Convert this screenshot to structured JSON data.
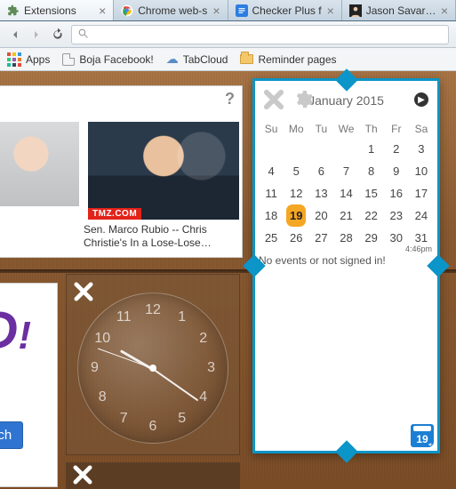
{
  "tabs": [
    {
      "title": "Extensions"
    },
    {
      "title": "Chrome web-s"
    },
    {
      "title": "Checker Plus f"
    },
    {
      "title": "Jason Savard -"
    }
  ],
  "toolbar": {
    "omnibox_placeholder": ""
  },
  "bookmarks": {
    "apps": "Apps",
    "items": [
      {
        "label": "Boja Facebook!"
      },
      {
        "label": "TabCloud"
      },
      {
        "label": "Reminder pages"
      }
    ]
  },
  "news": {
    "help": "?",
    "badge": "TMZ.COM",
    "caption": "Sen. Marco Rubio -- Chris Christie's In a Lose-Lose…"
  },
  "yahoo": {
    "search_label": "arch"
  },
  "clock": {
    "numbers": [
      "12",
      "1",
      "2",
      "3",
      "4",
      "5",
      "6",
      "7",
      "8",
      "9",
      "10",
      "11"
    ]
  },
  "calendar": {
    "title": "January 2015",
    "weekdays": [
      "Su",
      "Mo",
      "Tu",
      "We",
      "Th",
      "Fr",
      "Sa"
    ],
    "rows": [
      [
        "",
        "",
        "",
        "",
        "1",
        "2",
        "3"
      ],
      [
        "4",
        "5",
        "6",
        "7",
        "8",
        "9",
        "10"
      ],
      [
        "11",
        "12",
        "13",
        "14",
        "15",
        "16",
        "17"
      ],
      [
        "18",
        "19",
        "20",
        "21",
        "22",
        "23",
        "24"
      ],
      [
        "25",
        "26",
        "27",
        "28",
        "29",
        "30",
        "31"
      ]
    ],
    "today": "19",
    "time": "4:46pm",
    "message": "No events or not signed in!",
    "badge_day": "19"
  }
}
